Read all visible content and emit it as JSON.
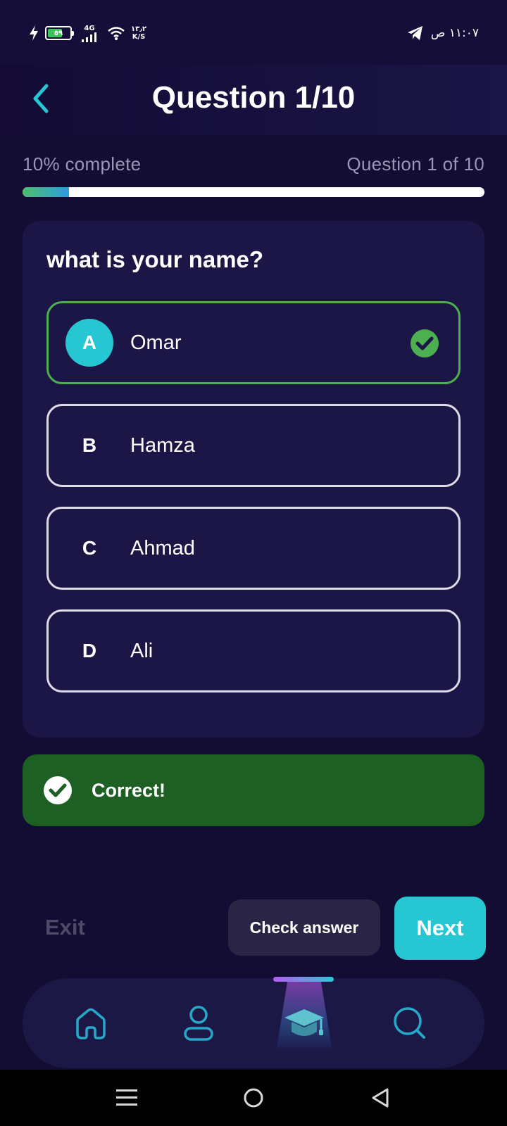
{
  "status_bar": {
    "battery_level": "٥٩",
    "network_type": "4G",
    "net_speed_value": "١٣٫٢",
    "net_speed_unit": "K/S",
    "time": "١١:٠٧ ص"
  },
  "header": {
    "title": "Question 1/10"
  },
  "progress": {
    "percent_label": "10% complete",
    "question_counter": "Question 1 of 10",
    "fraction": 0.1
  },
  "question": {
    "text": "what is your name?",
    "options": [
      {
        "letter": "A",
        "text": "Omar",
        "state": "correct"
      },
      {
        "letter": "B",
        "text": "Hamza",
        "state": "default"
      },
      {
        "letter": "C",
        "text": "Ahmad",
        "state": "default"
      },
      {
        "letter": "D",
        "text": "Ali",
        "state": "default"
      }
    ]
  },
  "feedback": {
    "text": "Correct!"
  },
  "actions": {
    "exit_label": "Exit",
    "check_label": "Check answer",
    "next_label": "Next"
  },
  "bottom_nav": {
    "items": [
      {
        "icon": "home-icon",
        "active": false
      },
      {
        "icon": "profile-icon",
        "active": false
      },
      {
        "icon": "graduation-cap-icon",
        "active": true
      },
      {
        "icon": "search-icon",
        "active": false
      }
    ]
  },
  "colors": {
    "background": "#130c33",
    "card": "#1c1646",
    "accent": "#26c6d3",
    "correct_border": "#4caf50",
    "feedback_bg": "#1e5f23"
  }
}
